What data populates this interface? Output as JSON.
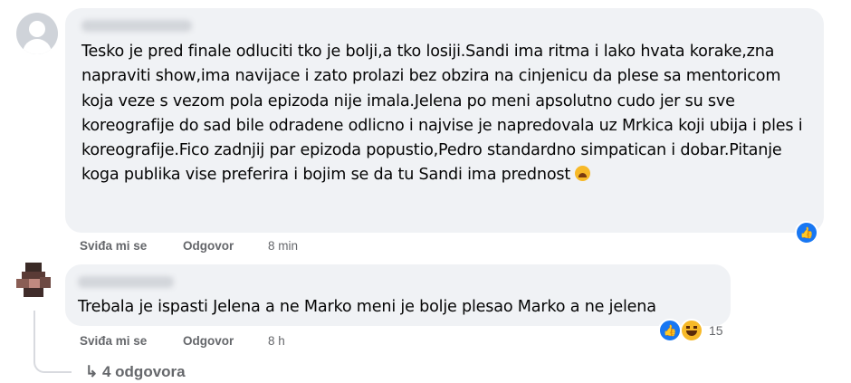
{
  "comments": [
    {
      "text": "Tesko je pred finale odluciti tko je bolji,a tko losiji.Sandi ima ritma i lako hvata korake,zna napraviti show,ima navijace i zato prolazi bez obzira na cinjenicu da plese sa mentoricom koja veze s vezom pola epizoda nije imala.Jelena po meni apsolutno cudo jer su sve koreografije do sad bile odradene odlicno i najvise je napredovala uz Mrkica koji ubija i ples i koreografije.Fico zadnjij par epizoda popustio,Pedro standardno simpatican i dobar.Pitanje koga publika vise preferira i bojim se da tu Sandi ima prednost",
      "like_label": "Sviđa mi se",
      "reply_label": "Odgovor",
      "time": "8 min",
      "reactions": [
        "like-icon"
      ]
    },
    {
      "text": "Trebala je ispasti Jelena a ne Marko meni je bolje plesao Marko a ne jelena",
      "like_label": "Sviđa mi se",
      "reply_label": "Odgovor",
      "time": "8 h",
      "reactions": [
        "like-icon",
        "haha-icon"
      ],
      "reaction_count": "15"
    }
  ],
  "replies_link": "4 odgovora",
  "colors": {
    "bubble": "#f0f2f5",
    "meta": "#65676b",
    "like": "#1877f2"
  }
}
